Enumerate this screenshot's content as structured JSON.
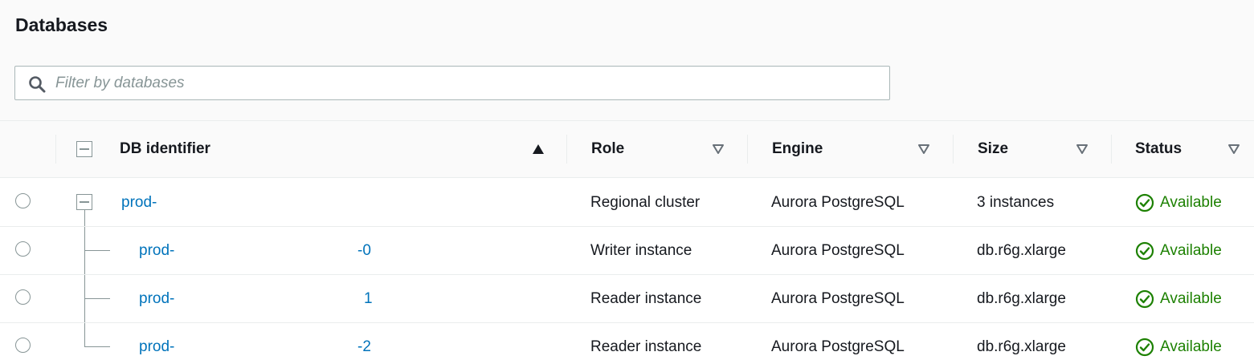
{
  "panel": {
    "title": "Databases"
  },
  "search": {
    "placeholder": "Filter by databases",
    "value": ""
  },
  "table": {
    "columns": {
      "identifier": "DB identifier",
      "role": "Role",
      "engine": "Engine",
      "size": "Size",
      "status": "Status"
    },
    "sort": {
      "column": "DB identifier",
      "direction": "ascending"
    },
    "rows": [
      {
        "id_prefix": "prod-",
        "id_suffix": "",
        "role": "Regional cluster",
        "engine": "Aurora PostgreSQL",
        "size": "3 instances",
        "status": "Available"
      },
      {
        "id_prefix": "prod-",
        "id_suffix": "-0",
        "role": "Writer instance",
        "engine": "Aurora PostgreSQL",
        "size": "db.r6g.xlarge",
        "status": "Available"
      },
      {
        "id_prefix": "prod-",
        "id_suffix": "1",
        "role": "Reader instance",
        "engine": "Aurora PostgreSQL",
        "size": "db.r6g.xlarge",
        "status": "Available"
      },
      {
        "id_prefix": "prod-",
        "id_suffix": "-2",
        "role": "Reader instance",
        "engine": "Aurora PostgreSQL",
        "size": "db.r6g.xlarge",
        "status": "Available"
      }
    ]
  },
  "icons": {
    "search": "search-icon",
    "collapse": "collapse-icon",
    "sort_asc": "caret-up-icon",
    "sort_none": "caret-down-outline-icon",
    "status_ok": "check-circle-icon"
  },
  "colors": {
    "link": "#0073bb",
    "status_ok": "#1d8102",
    "border": "#aab7b8",
    "header_bg": "#fafafa"
  }
}
